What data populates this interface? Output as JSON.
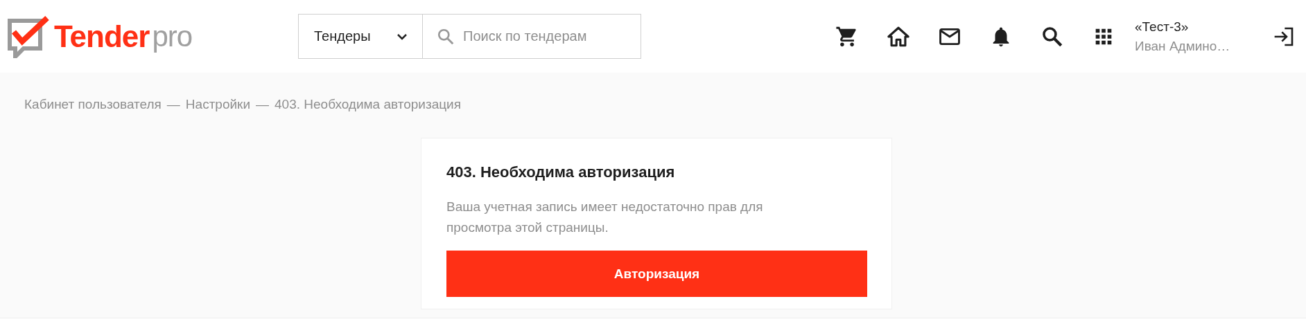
{
  "header": {
    "logo": {
      "brand": "Tender",
      "suffix": "pro"
    },
    "category_select": {
      "value": "Тендеры"
    },
    "search": {
      "placeholder": "Поиск по тендерам"
    },
    "user": {
      "company": "«Тест-3»",
      "name": "Иван Админо…"
    }
  },
  "breadcrumbs": [
    {
      "label": "Кабинет пользователя"
    },
    {
      "label": "Настройки"
    },
    {
      "label": "403. Необходима авторизация"
    }
  ],
  "breadcrumb_separator": "—",
  "card": {
    "title": "403. Необходима авторизация",
    "message": "Ваша учетная запись имеет недостаточно прав для просмотра этой страницы.",
    "button": "Авторизация"
  }
}
